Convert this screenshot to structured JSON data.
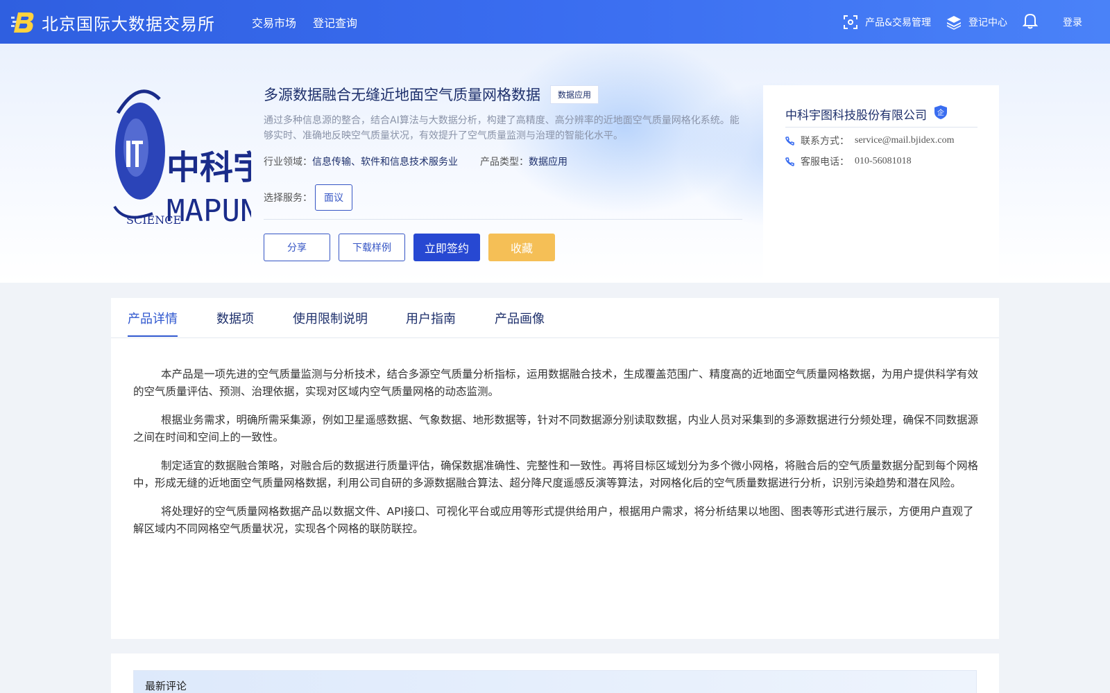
{
  "header": {
    "brand_name": "北京国际大数据交易所",
    "nav": [
      {
        "label": "交易市场"
      },
      {
        "label": "登记查询"
      }
    ],
    "right": {
      "product_mgmt": "产品&交易管理",
      "registry_center": "登记中心",
      "login": "登录"
    }
  },
  "product": {
    "logo_text": {
      "cn": "中科宇图",
      "en": "MAPUNI",
      "sub": "SCIENCE"
    },
    "title": "多源数据融合无缝近地面空气质量网格数据",
    "tag": "数据应用",
    "description": "通过多种信息源的整合，结合AI算法与大数据分析，构建了高精度、高分辨率的近地面空气质量网格化系统。能够实时、准确地反映空气质量状况，有效提升了空气质量监测与治理的智能化水平。",
    "industry_label": "行业领域：",
    "industry_value": "信息传输、软件和信息技术服务业",
    "type_label": "产品类型：",
    "type_value": "数据应用",
    "service_label": "选择服务：",
    "service_option": "面议",
    "actions": {
      "share": "分享",
      "download_sample": "下载样例",
      "sign_now": "立即签约",
      "favorite": "收藏"
    }
  },
  "company": {
    "name": "中科宇图科技股份有限公司",
    "badge": "企",
    "contact_label": "联系方式：",
    "contact_value": "service@mail.bjidex.com",
    "phone_label": "客服电话：",
    "phone_value": "010-56081018"
  },
  "tabs": [
    {
      "label": "产品详情",
      "active": true
    },
    {
      "label": "数据项"
    },
    {
      "label": "使用限制说明"
    },
    {
      "label": "用户指南"
    },
    {
      "label": "产品画像"
    }
  ],
  "details": {
    "paragraphs": [
      "本产品是一项先进的空气质量监测与分析技术，结合多源空气质量分析指标，运用数据融合技术，生成覆盖范围广、精度高的近地面空气质量网格数据，为用户提供科学有效的空气质量评估、预测、治理依据，实现对区域内空气质量网格的动态监测。",
      "根据业务需求，明确所需采集源，例如卫星遥感数据、气象数据、地形数据等，针对不同数据源分别读取数据，内业人员对采集到的多源数据进行分频处理，确保不同数据源之间在时间和空间上的一致性。",
      "制定适宜的数据融合策略，对融合后的数据进行质量评估，确保数据准确性、完整性和一致性。再将目标区域划分为多个微小网格，将融合后的空气质量数据分配到每个网格中，形成无缝的近地面空气质量网格数据，利用公司自研的多源数据融合算法、超分降尺度遥感反演等算法，对网格化后的空气质量数据进行分析，识别污染趋势和潜在风险。",
      "将处理好的空气质量网格数据产品以数据文件、API接口、可视化平台或应用等形式提供给用户，根据用户需求，将分析结果以地图、图表等形式进行展示，方便用户直观了解区域内不同网格空气质量状况，实现各个网格的联防联控。"
    ]
  },
  "comments": {
    "title": "最新评论"
  },
  "colors": {
    "topbar": "#3a6df0",
    "primary": "#2748d2",
    "favorite": "#f5bf56",
    "title": "#1d2f6b"
  }
}
